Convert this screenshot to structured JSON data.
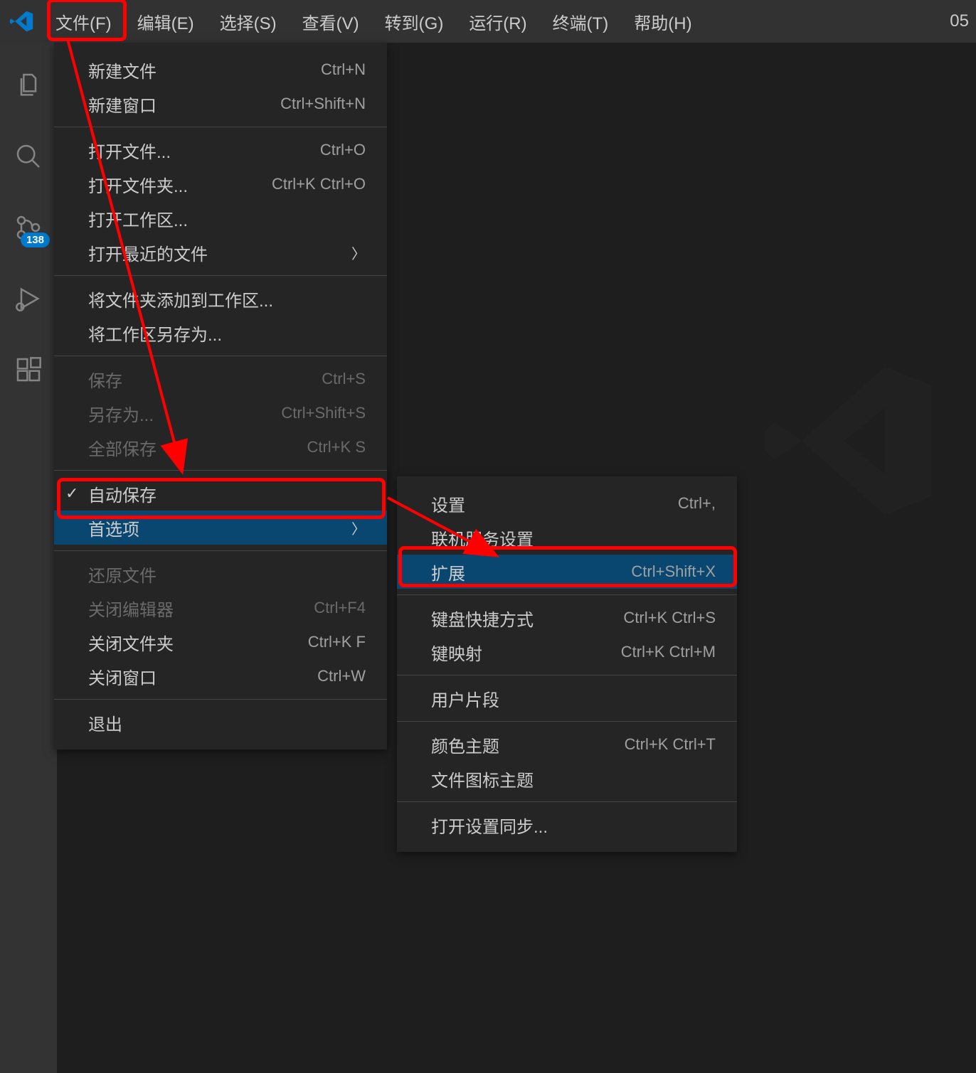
{
  "menubar": {
    "items": [
      {
        "label": "文件(F)"
      },
      {
        "label": "编辑(E)"
      },
      {
        "label": "选择(S)"
      },
      {
        "label": "查看(V)"
      },
      {
        "label": "转到(G)"
      },
      {
        "label": "运行(R)"
      },
      {
        "label": "终端(T)"
      },
      {
        "label": "帮助(H)"
      }
    ],
    "right": "05"
  },
  "activitybar": {
    "badge": "138"
  },
  "file_menu": {
    "new_file": {
      "label": "新建文件",
      "shortcut": "Ctrl+N"
    },
    "new_window": {
      "label": "新建窗口",
      "shortcut": "Ctrl+Shift+N"
    },
    "open_file": {
      "label": "打开文件...",
      "shortcut": "Ctrl+O"
    },
    "open_folder": {
      "label": "打开文件夹...",
      "shortcut": "Ctrl+K Ctrl+O"
    },
    "open_workspace": {
      "label": "打开工作区..."
    },
    "open_recent": {
      "label": "打开最近的文件"
    },
    "add_folder": {
      "label": "将文件夹添加到工作区..."
    },
    "save_workspace_as": {
      "label": "将工作区另存为..."
    },
    "save": {
      "label": "保存",
      "shortcut": "Ctrl+S"
    },
    "save_as": {
      "label": "另存为...",
      "shortcut": "Ctrl+Shift+S"
    },
    "save_all": {
      "label": "全部保存",
      "shortcut": "Ctrl+K S"
    },
    "auto_save": {
      "label": "自动保存"
    },
    "preferences": {
      "label": "首选项"
    },
    "revert_file": {
      "label": "还原文件"
    },
    "close_editor": {
      "label": "关闭编辑器",
      "shortcut": "Ctrl+F4"
    },
    "close_folder": {
      "label": "关闭文件夹",
      "shortcut": "Ctrl+K F"
    },
    "close_window": {
      "label": "关闭窗口",
      "shortcut": "Ctrl+W"
    },
    "exit": {
      "label": "退出"
    }
  },
  "preferences_submenu": {
    "settings": {
      "label": "设置",
      "shortcut": "Ctrl+,"
    },
    "online_settings": {
      "label": "联机服务设置"
    },
    "extensions": {
      "label": "扩展",
      "shortcut": "Ctrl+Shift+X"
    },
    "keyboard_shortcuts": {
      "label": "键盘快捷方式",
      "shortcut": "Ctrl+K Ctrl+S"
    },
    "keymaps": {
      "label": "键映射",
      "shortcut": "Ctrl+K Ctrl+M"
    },
    "user_snippets": {
      "label": "用户片段"
    },
    "color_theme": {
      "label": "颜色主题",
      "shortcut": "Ctrl+K Ctrl+T"
    },
    "file_icon_theme": {
      "label": "文件图标主题"
    },
    "settings_sync": {
      "label": "打开设置同步..."
    }
  }
}
